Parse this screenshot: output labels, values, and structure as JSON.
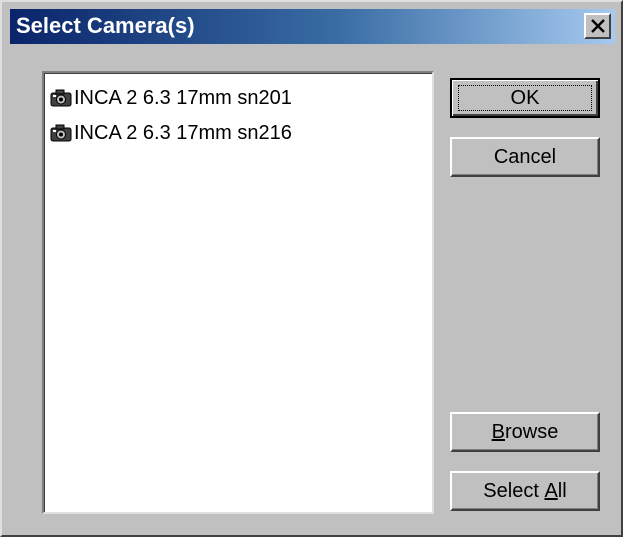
{
  "window": {
    "title": "Select Camera(s)",
    "close_icon": "close-icon"
  },
  "camera_list": {
    "items": [
      {
        "icon": "camera-icon",
        "label": "INCA 2 6.3 17mm sn201"
      },
      {
        "icon": "camera-icon",
        "label": "INCA 2 6.3 17mm sn216"
      }
    ]
  },
  "buttons": {
    "ok": "OK",
    "cancel": "Cancel",
    "browse": {
      "mnemonic": "B",
      "rest": "rowse"
    },
    "select_all": {
      "prefix": "Select ",
      "mnemonic": "A",
      "rest": "ll"
    }
  },
  "colors": {
    "titlebar_start": "#0a246a",
    "titlebar_end": "#a6caf0",
    "face": "#c0c0c0"
  }
}
